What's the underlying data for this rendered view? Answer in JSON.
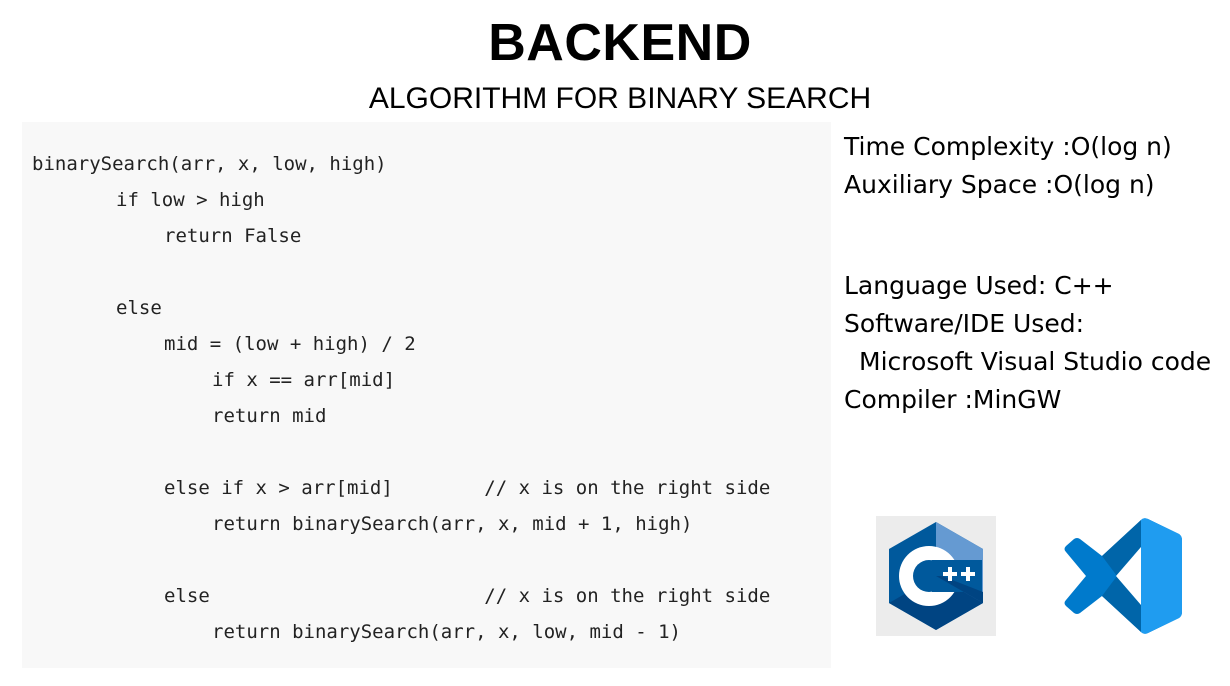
{
  "header": {
    "title": "BACKEND",
    "subtitle": "ALGORITHM FOR BINARY SEARCH"
  },
  "code": {
    "lines": [
      "binarySearch(arr, x, low, high)",
      "if low > high",
      "return False",
      "else",
      "mid = (low + high) / 2",
      "if x == arr[mid]",
      "return mid",
      "else if x > arr[mid]        // x is on the right side",
      "return binarySearch(arr, x, mid + 1, high)",
      "else                        // x is on the right side",
      "return binarySearch(arr, x, low, mid - 1)"
    ]
  },
  "info": {
    "time_complexity": "Time Complexity :O(log n)",
    "auxiliary_space": "Auxiliary Space :O(log n)",
    "language": "Language Used: C++",
    "software_ide": "Software/IDE Used:",
    "ide_name": "Microsoft Visual Studio code",
    "compiler": "Compiler :MinGW"
  },
  "logos": {
    "cpp": {
      "icon": "cpp-logo-icon",
      "label": "C++",
      "colors": {
        "dark": "#00599c",
        "mid": "#004482",
        "light": "#659ad2",
        "text": "#ffffff"
      }
    },
    "vscode": {
      "icon": "vscode-logo-icon",
      "colors": {
        "dark": "#0065a9",
        "mid": "#007acc",
        "light": "#1f9cf0"
      }
    }
  }
}
